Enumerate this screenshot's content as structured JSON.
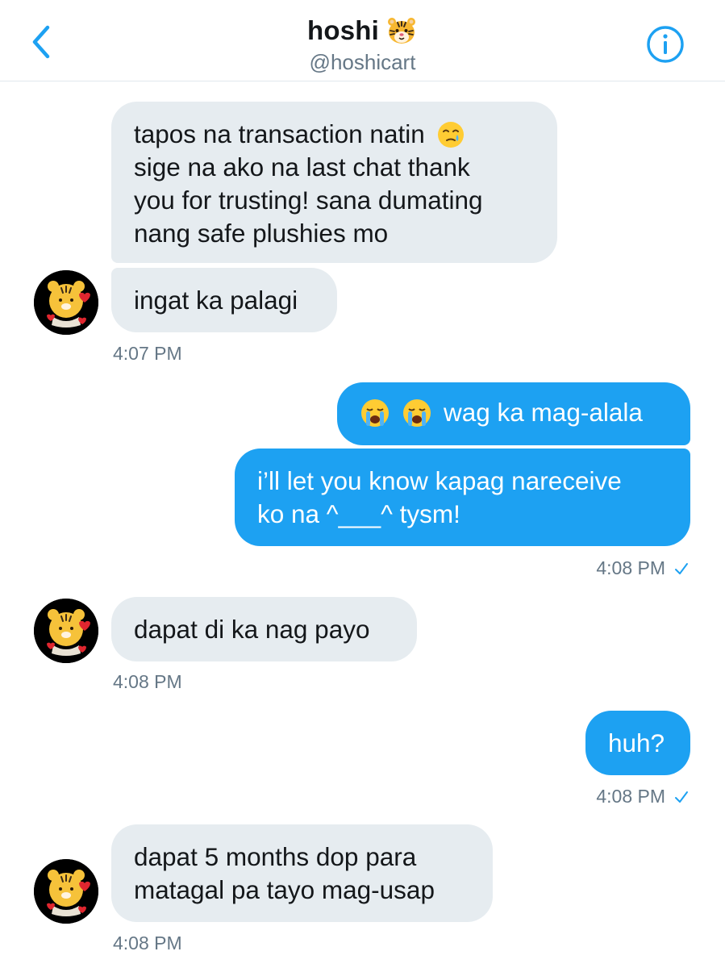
{
  "header": {
    "name": "hoshi",
    "name_emoji": "tiger-face-emoji",
    "handle": "@hoshicart",
    "back_icon": "chevron-left-icon",
    "info_icon": "info-circle-icon",
    "accent_color": "#1da1f2"
  },
  "messages": [
    {
      "from": "them",
      "lines": [
        "tapos na transaction natin",
        "sige na ako na last chat thank",
        "you for trusting! sana dumating",
        "nang safe plushies mo"
      ],
      "emoji": "face-holding-back-tears-emoji"
    },
    {
      "from": "them",
      "lines": [
        "ingat ka palagi"
      ],
      "time": "4:07 PM"
    },
    {
      "from": "me",
      "lines": [
        "wag ka mag-alala"
      ],
      "emoji": [
        "loudly-crying-face-emoji",
        "loudly-crying-face-emoji"
      ]
    },
    {
      "from": "me",
      "lines": [
        "i’ll let you know kapag nareceive",
        "ko na ^___^ tysm!"
      ],
      "time": "4:08 PM"
    },
    {
      "from": "them",
      "lines": [
        "dapat di ka nag payo"
      ],
      "time": "4:08 PM"
    },
    {
      "from": "me",
      "lines": [
        "huh?"
      ],
      "time": "4:08 PM"
    },
    {
      "from": "them",
      "lines": [
        "dapat 5 months dop para",
        "matagal pa tayo mag-usap"
      ],
      "time": "4:08 PM"
    }
  ],
  "avatar_icon": "tiger-plush-avatar",
  "check_icon": "checkmark-icon",
  "colors": {
    "incoming_bubble": "#e6ecf0",
    "outgoing_bubble": "#1da1f2",
    "timestamp": "#657786"
  }
}
